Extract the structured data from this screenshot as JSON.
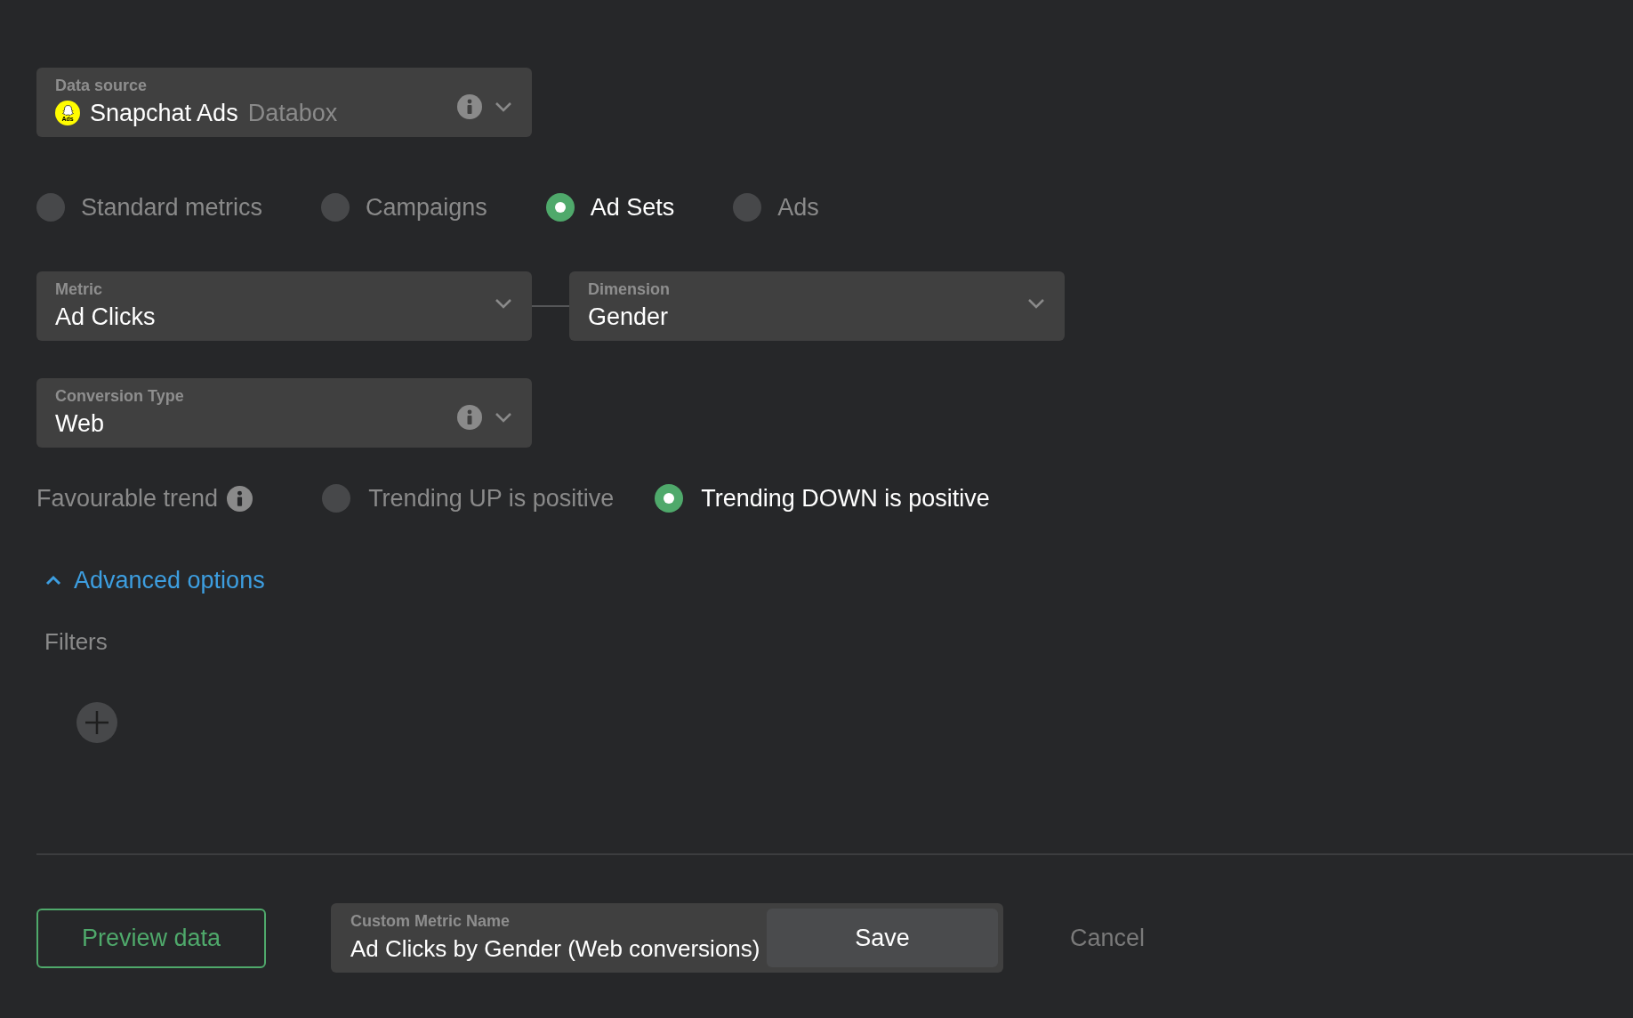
{
  "data_source": {
    "label": "Data source",
    "logo_text": "Ads",
    "value": "Snapchat Ads",
    "provider": "Databox"
  },
  "source_types": [
    {
      "label": "Standard metrics",
      "selected": false
    },
    {
      "label": "Campaigns",
      "selected": false
    },
    {
      "label": "Ad Sets",
      "selected": true
    },
    {
      "label": "Ads",
      "selected": false
    }
  ],
  "metric": {
    "label": "Metric",
    "value": "Ad Clicks"
  },
  "dimension": {
    "label": "Dimension",
    "value": "Gender"
  },
  "conversion_type": {
    "label": "Conversion Type",
    "value": "Web"
  },
  "favourable_trend": {
    "label": "Favourable trend",
    "options": [
      {
        "label": "Trending UP is positive",
        "selected": false
      },
      {
        "label": "Trending DOWN is positive",
        "selected": true
      }
    ]
  },
  "advanced_options": {
    "label": "Advanced options",
    "expanded": true
  },
  "filters": {
    "label": "Filters"
  },
  "preview_button": "Preview data",
  "custom_metric_name": {
    "label": "Custom Metric Name",
    "value": "Ad Clicks by Gender (Web conversions)"
  },
  "save_button": "Save",
  "cancel_button": "Cancel"
}
